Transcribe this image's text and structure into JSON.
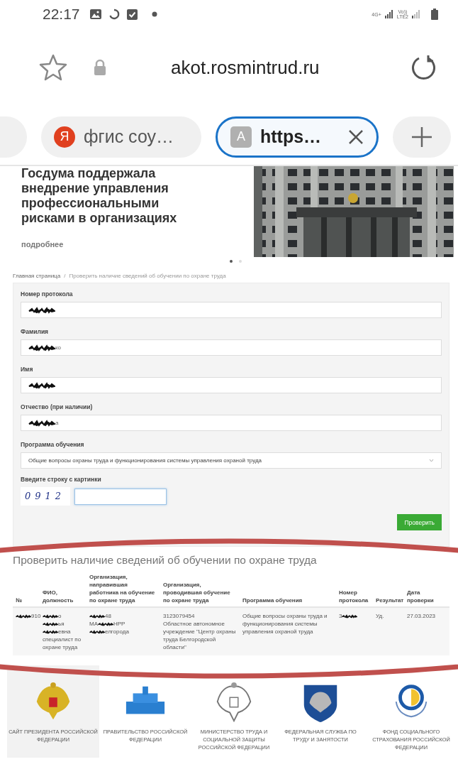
{
  "status_bar": {
    "time": "22:17",
    "network_label": "4G+",
    "volte_label_top": "Vo))",
    "volte_label_bottom": "LTE2"
  },
  "address_bar": {
    "url": "akot.rosmintrud.ru"
  },
  "tabs": [
    {
      "kind": "partial",
      "selected": false
    },
    {
      "kind": "page",
      "favicon": {
        "kind": "round",
        "letter": "Я"
      },
      "title": "фгис соу…",
      "selected": false
    },
    {
      "kind": "page",
      "favicon": {
        "kind": "square",
        "letter": "A"
      },
      "title": "https…",
      "selected": true
    }
  ],
  "hero": {
    "title": "Госдума поддержала внедрение управления профессиональными рисками в организациях",
    "more_link": "подробнее",
    "slides": [
      {
        "selected": true
      },
      {
        "selected": false
      }
    ]
  },
  "breadcrumb": {
    "items": [
      "Главная страница",
      "Проверить наличие сведений об обучении по охране труда"
    ],
    "separator": "/"
  },
  "form": {
    "fields": [
      {
        "label": "Номер протокола",
        "kind": "redacted"
      },
      {
        "label": "Фамилия",
        "kind": "redacted",
        "value_tail": "ко"
      },
      {
        "label": "Имя",
        "kind": "redacted"
      },
      {
        "label": "Отчество (при наличии)",
        "kind": "redacted",
        "value_tail": "а"
      },
      {
        "label": "Программа обучения",
        "kind": "select",
        "value": "Общие вопросы охраны труда и функционирования системы управления охраной труда"
      }
    ],
    "captcha": {
      "label": "Введите строку с картинки",
      "image_text": "0912",
      "focused": true
    },
    "submit": "Проверить"
  },
  "results": {
    "title": "Проверить наличие сведений об обучении по охране труда",
    "columns": [
      "№",
      "ФИО, должность",
      "Организация, направившая работника на обучение по охране труда",
      "Организация, проводившая обучение по охране труда",
      "Программа обучения",
      "Номер протокола",
      "Результат",
      "Дата проверки"
    ],
    "rows": [
      {
        "cells": [
          {
            "lines": [
              {
                "kind": "redacted",
                "after": "910"
              }
            ]
          },
          {
            "lines": [
              {
                "kind": "redacted",
                "after": "о"
              },
              {
                "kind": "redacted",
                "after": "ья"
              },
              {
                "kind": "redacted",
                "after": "евна"
              },
              {
                "kind": "text",
                "text": "специалист по охране труда"
              }
            ]
          },
          {
            "lines": [
              {
                "kind": "redacted",
                "after": "48"
              },
              {
                "kind": "redacted",
                "before": "МА",
                "after": "НРР"
              },
              {
                "kind": "redacted",
                "after": "елгорода"
              }
            ]
          },
          {
            "lines": [
              {
                "kind": "text",
                "text": "3123079454"
              },
              {
                "kind": "text",
                "text": "Областное автономное учреждение \"Центр охраны труда Белгородской области\""
              }
            ]
          },
          {
            "lines": [
              {
                "kind": "text",
                "text": "Общие вопросы охраны труда и функционирования системы управления охраной труда"
              }
            ]
          },
          {
            "lines": [
              {
                "kind": "redacted",
                "before": "3"
              }
            ]
          },
          {
            "lines": [
              {
                "kind": "text",
                "text": "Уд."
              }
            ]
          },
          {
            "lines": [
              {
                "kind": "text",
                "text": "27.03.2023"
              }
            ]
          }
        ]
      }
    ]
  },
  "annotation": {
    "kind": "ellipse",
    "color": "#c0504d"
  },
  "footer": {
    "links": [
      {
        "kind": "gold-eagle",
        "label": "САЙТ ПРЕЗИДЕНТА РОССИЙСКОЙ ФЕДЕРАЦИИ",
        "highlighted": true
      },
      {
        "kind": "building",
        "label": "ПРАВИТЕЛЬСТВО РОССИЙСКОЙ ФЕДЕРАЦИИ",
        "highlighted": false
      },
      {
        "kind": "grey-eagle",
        "label": "МИНИСТЕРСТВО ТРУДА И СОЦИАЛЬНОЙ ЗАЩИТЫ РОССИЙСКОЙ ФЕДЕРАЦИИ",
        "highlighted": false
      },
      {
        "kind": "shield",
        "label": "ФЕДЕРАЛЬНАЯ СЛУЖБА ПО ТРУДУ И ЗАНЯТОСТИ",
        "highlighted": false
      },
      {
        "kind": "round",
        "label": "ФОНД СОЦИАЛЬНОГО СТРАХОВАНИЯ РОССИЙСКОЙ ФЕДЕРАЦИИ",
        "highlighted": false
      }
    ]
  }
}
